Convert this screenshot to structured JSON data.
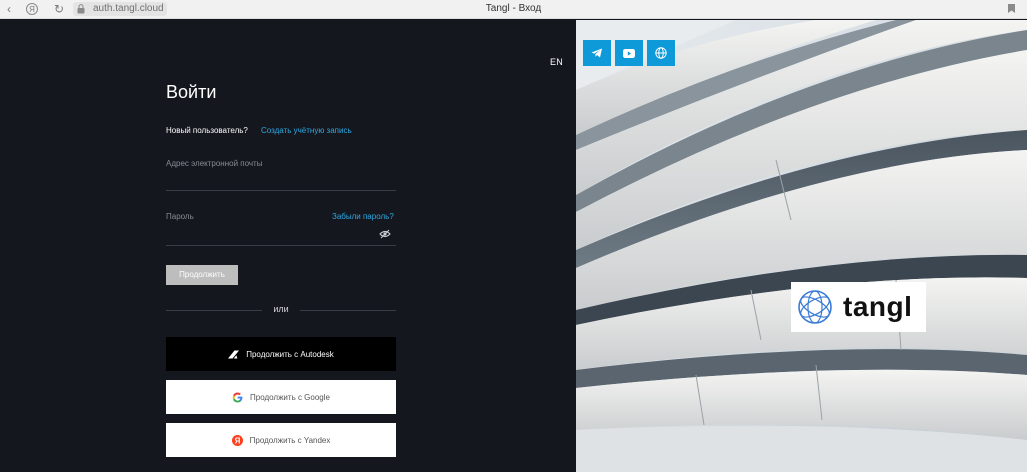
{
  "browser": {
    "url": "auth.tangl.cloud",
    "title": "Tangl - Вход"
  },
  "login": {
    "lang": "EN",
    "heading": "Войти",
    "new_user": "Новый пользователь?",
    "create_account": "Создать учётную запись",
    "email_label": "Адрес электронной почты",
    "password_label": "Пароль",
    "forgot_password": "Забыли пароль?",
    "continue_label": "Продолжить",
    "or_label": "или",
    "autodesk_label": "Продолжить с Autodesk",
    "google_label": "Продолжить с Google",
    "yandex_label": "Продолжить с Yandex"
  },
  "social": {
    "icons": [
      "telegram-icon",
      "youtube-icon",
      "globe-icon"
    ]
  },
  "brand": {
    "logo_text": "tangl",
    "accent": "#0e99d8",
    "link_color": "#2fa8e0",
    "logo_color": "#3a7bd5"
  }
}
